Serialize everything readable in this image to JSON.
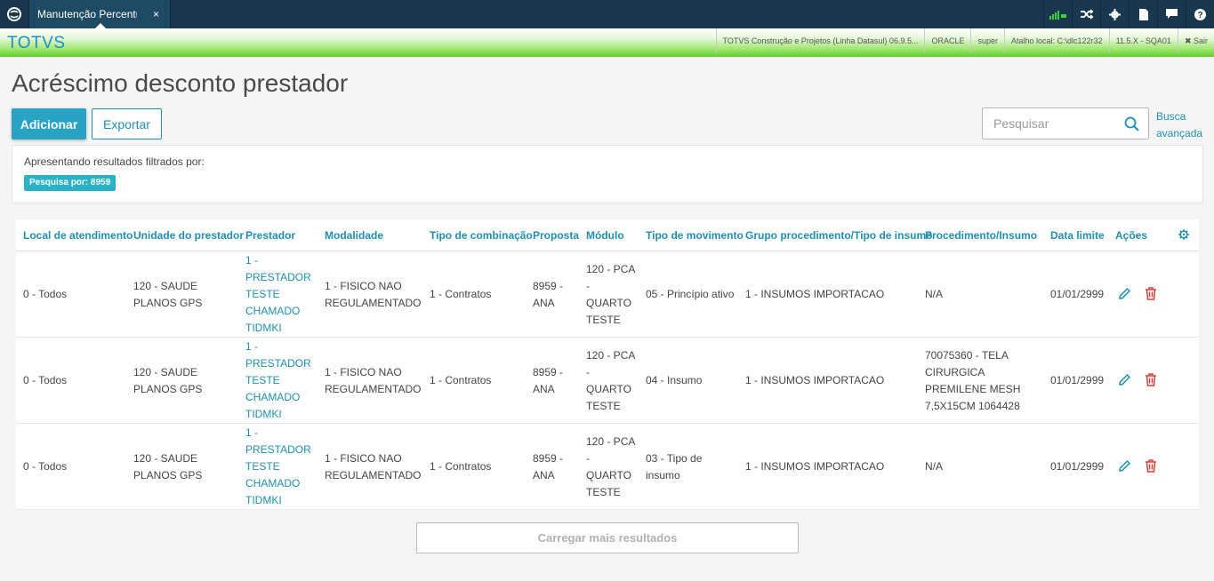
{
  "topbar": {
    "tab_label": "Manutenção Percentual",
    "tab_close": "×",
    "icons": [
      "signal-icon",
      "shuffle-icon",
      "gear-icon",
      "document-icon",
      "chat-icon",
      "help-icon"
    ]
  },
  "brandbar": {
    "brand": "TOTVS",
    "company": "TOTVS Construção e Projetos (Linha Datasul) 06.9.5...",
    "database": "ORACLE",
    "user": "super",
    "shortcut": "Atalho local: C:\\dlc122r32",
    "version": "11.5.X - SQA01",
    "exit_label": "Sair"
  },
  "page": {
    "title": "Acréscimo desconto prestador",
    "add_label": "Adicionar",
    "export_label": "Exportar",
    "search_placeholder": "Pesquisar",
    "advanced_search": "Busca avançada",
    "filter_label": "Apresentando resultados filtrados por:",
    "filter_tag": "Pesquisa por: 8959",
    "load_more": "Carregar mais resultados"
  },
  "table": {
    "headers": [
      "Local de atendimento",
      "Unidade do prestador",
      "Prestador",
      "Modalidade",
      "Tipo de combinação",
      "Proposta",
      "Módulo",
      "Tipo de movimento",
      "Grupo procedimento/Tipo de insumo",
      "Procedimento/Insumo",
      "Data limite",
      "Ações"
    ],
    "rows": [
      {
        "local": "0 - Todos",
        "unidade": "120 - SAUDE PLANOS GPS",
        "prestador": "1 - PRESTADOR TESTE CHAMADO TIDMKI",
        "modalidade": "1 - FISICO NAO REGULAMENTADO",
        "combinacao": "1 - Contratos",
        "proposta": "8959 - ANA",
        "modulo": "120 - PCA - QUARTO TESTE",
        "movimento": "05 - Princípio ativo",
        "grupo": "1 - INSUMOS IMPORTACAO",
        "procedimento": "N/A",
        "data": "01/01/2999"
      },
      {
        "local": "0 - Todos",
        "unidade": "120 - SAUDE PLANOS GPS",
        "prestador": "1 - PRESTADOR TESTE CHAMADO TIDMKI",
        "modalidade": "1 - FISICO NAO REGULAMENTADO",
        "combinacao": "1 - Contratos",
        "proposta": "8959 - ANA",
        "modulo": "120 - PCA - QUARTO TESTE",
        "movimento": "04 - Insumo",
        "grupo": "1 - INSUMOS IMPORTACAO",
        "procedimento": "70075360 - TELA CIRURGICA PREMILENE MESH 7,5X15CM 1064428",
        "data": "01/01/2999"
      },
      {
        "local": "0 - Todos",
        "unidade": "120 - SAUDE PLANOS GPS",
        "prestador": "1 - PRESTADOR TESTE CHAMADO TIDMKI",
        "modalidade": "1 - FISICO NAO REGULAMENTADO",
        "combinacao": "1 - Contratos",
        "proposta": "8959 - ANA",
        "modulo": "120 - PCA - QUARTO TESTE",
        "movimento": "03 - Tipo de insumo",
        "grupo": "1 - INSUMOS IMPORTACAO",
        "procedimento": "N/A",
        "data": "01/01/2999"
      }
    ]
  },
  "colors": {
    "topbar": "#17384d",
    "accent": "#29a3c4",
    "link": "#1e8fb0",
    "delete": "#d9403a",
    "brand": "#1e8fc4"
  }
}
